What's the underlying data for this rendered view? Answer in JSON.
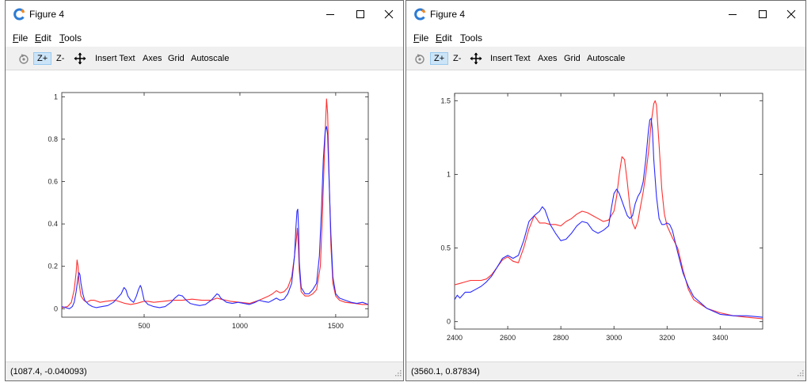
{
  "windows": [
    {
      "id": "left",
      "title": "Figure 4",
      "menu": [
        {
          "label": "File",
          "accel": "F",
          "rest": "ile"
        },
        {
          "label": "Edit",
          "accel": "E",
          "rest": "dit"
        },
        {
          "label": "Tools",
          "accel": "T",
          "rest": "ools"
        }
      ],
      "toolbar": {
        "zoom_in": "Z+",
        "zoom_out": "Z-",
        "insert_text": "Insert Text",
        "axes": "Axes",
        "grid": "Grid",
        "autoscale": "Autoscale"
      },
      "status": "(1087.4, -0.040093)"
    },
    {
      "id": "right",
      "title": "Figure 4",
      "menu": [
        {
          "label": "File",
          "accel": "F",
          "rest": "ile"
        },
        {
          "label": "Edit",
          "accel": "E",
          "rest": "dit"
        },
        {
          "label": "Tools",
          "accel": "T",
          "rest": "ools"
        }
      ],
      "toolbar": {
        "zoom_in": "Z+",
        "zoom_out": "Z-",
        "insert_text": "Insert Text",
        "axes": "Axes",
        "grid": "Grid",
        "autoscale": "Autoscale"
      },
      "status": "(3560.1, 0.87834)"
    }
  ],
  "icons": {
    "app": "octave-logo-icon",
    "minimize": "minimize-icon",
    "maximize": "maximize-icon",
    "close": "close-icon",
    "rotate": "rotate-icon",
    "pan": "pan-icon"
  },
  "colors": {
    "series_red": "#ff3030",
    "series_blue": "#2a2aff",
    "zoom_active_bg": "#cce4f7"
  },
  "chart_data": [
    {
      "type": "line",
      "xlim": [
        70,
        1670
      ],
      "ylim": [
        -0.04,
        1.02
      ],
      "xticks": [
        500,
        1000,
        1500
      ],
      "yticks": [
        0,
        0.2,
        0.4,
        0.6,
        0.8,
        1
      ],
      "ytick_labels": [
        "0",
        "0.2",
        "0.4",
        "0.6",
        "0.8",
        "1"
      ],
      "grid": false,
      "series": [
        {
          "color": "#ff3030",
          "x": [
            70,
            100,
            120,
            135,
            145,
            150,
            155,
            160,
            170,
            185,
            200,
            220,
            240,
            270,
            300,
            350,
            400,
            430,
            460,
            480,
            500,
            520,
            550,
            600,
            650,
            700,
            750,
            800,
            850,
            880,
            900,
            950,
            1000,
            1050,
            1100,
            1150,
            1170,
            1190,
            1210,
            1230,
            1250,
            1270,
            1285,
            1295,
            1300,
            1305,
            1310,
            1320,
            1340,
            1360,
            1380,
            1400,
            1420,
            1430,
            1440,
            1447,
            1452,
            1458,
            1465,
            1475,
            1485,
            1500,
            1520,
            1550,
            1600,
            1640,
            1670
          ],
          "y": [
            0.005,
            0.01,
            0.03,
            0.09,
            0.17,
            0.23,
            0.2,
            0.12,
            0.06,
            0.04,
            0.03,
            0.04,
            0.04,
            0.03,
            0.035,
            0.04,
            0.025,
            0.02,
            0.025,
            0.03,
            0.035,
            0.035,
            0.03,
            0.035,
            0.04,
            0.04,
            0.045,
            0.04,
            0.04,
            0.05,
            0.045,
            0.035,
            0.03,
            0.025,
            0.04,
            0.06,
            0.07,
            0.085,
            0.075,
            0.08,
            0.1,
            0.15,
            0.25,
            0.33,
            0.38,
            0.3,
            0.18,
            0.08,
            0.06,
            0.06,
            0.07,
            0.09,
            0.2,
            0.42,
            0.7,
            0.88,
            0.99,
            0.92,
            0.65,
            0.3,
            0.12,
            0.06,
            0.04,
            0.03,
            0.025,
            0.02,
            0.02
          ]
        },
        {
          "color": "#2a2aff",
          "x": [
            70,
            90,
            110,
            125,
            135,
            145,
            155,
            160,
            165,
            170,
            180,
            190,
            200,
            210,
            230,
            250,
            280,
            310,
            340,
            360,
            380,
            395,
            405,
            415,
            430,
            445,
            460,
            470,
            480,
            485,
            490,
            500,
            520,
            550,
            580,
            610,
            640,
            660,
            680,
            700,
            720,
            740,
            760,
            790,
            820,
            850,
            870,
            880,
            890,
            900,
            930,
            960,
            990,
            1020,
            1050,
            1080,
            1100,
            1120,
            1150,
            1170,
            1190,
            1210,
            1230,
            1250,
            1270,
            1285,
            1292,
            1298,
            1302,
            1306,
            1310,
            1320,
            1340,
            1360,
            1380,
            1400,
            1415,
            1425,
            1435,
            1445,
            1452,
            1458,
            1465,
            1475,
            1485,
            1500,
            1520,
            1550,
            1580,
            1610,
            1640,
            1670
          ],
          "y": [
            0.01,
            0.005,
            0,
            0.01,
            0.03,
            0.08,
            0.15,
            0.17,
            0.16,
            0.12,
            0.07,
            0.04,
            0.03,
            0.02,
            0.01,
            0.005,
            0.01,
            0.015,
            0.03,
            0.05,
            0.07,
            0.1,
            0.09,
            0.06,
            0.04,
            0.03,
            0.06,
            0.09,
            0.11,
            0.1,
            0.08,
            0.04,
            0.02,
            0.01,
            0.005,
            0.01,
            0.03,
            0.05,
            0.065,
            0.06,
            0.04,
            0.025,
            0.02,
            0.015,
            0.02,
            0.04,
            0.06,
            0.07,
            0.065,
            0.05,
            0.03,
            0.025,
            0.03,
            0.025,
            0.02,
            0.03,
            0.04,
            0.035,
            0.03,
            0.04,
            0.05,
            0.04,
            0.045,
            0.07,
            0.12,
            0.25,
            0.38,
            0.46,
            0.47,
            0.38,
            0.22,
            0.1,
            0.07,
            0.07,
            0.09,
            0.12,
            0.25,
            0.45,
            0.7,
            0.84,
            0.86,
            0.82,
            0.62,
            0.35,
            0.15,
            0.07,
            0.05,
            0.04,
            0.03,
            0.025,
            0.03,
            0.02
          ]
        }
      ]
    },
    {
      "type": "line",
      "xlim": [
        2400,
        3560
      ],
      "ylim": [
        -0.05,
        1.55
      ],
      "xticks": [
        2400,
        2600,
        2800,
        3000,
        3200,
        3400
      ],
      "yticks": [
        0,
        0.5,
        1,
        1.5
      ],
      "ytick_labels": [
        "0",
        "0.5",
        "1",
        "1.5"
      ],
      "grid": false,
      "series": [
        {
          "color": "#ff3030",
          "x": [
            2400,
            2420,
            2440,
            2460,
            2480,
            2500,
            2520,
            2540,
            2560,
            2580,
            2600,
            2620,
            2640,
            2660,
            2680,
            2700,
            2720,
            2740,
            2760,
            2780,
            2800,
            2820,
            2840,
            2860,
            2880,
            2900,
            2920,
            2940,
            2960,
            2980,
            3000,
            3010,
            3020,
            3030,
            3040,
            3050,
            3060,
            3070,
            3080,
            3090,
            3100,
            3110,
            3120,
            3130,
            3140,
            3150,
            3155,
            3160,
            3170,
            3180,
            3190,
            3200,
            3220,
            3240,
            3260,
            3280,
            3300,
            3350,
            3400,
            3450,
            3500,
            3560
          ],
          "y": [
            0.25,
            0.26,
            0.27,
            0.28,
            0.28,
            0.28,
            0.29,
            0.32,
            0.37,
            0.42,
            0.44,
            0.41,
            0.4,
            0.5,
            0.63,
            0.72,
            0.67,
            0.67,
            0.66,
            0.66,
            0.65,
            0.68,
            0.7,
            0.73,
            0.75,
            0.74,
            0.72,
            0.7,
            0.68,
            0.69,
            0.75,
            0.85,
            1.0,
            1.12,
            1.1,
            0.95,
            0.78,
            0.67,
            0.63,
            0.68,
            0.78,
            0.88,
            1.0,
            1.15,
            1.35,
            1.48,
            1.5,
            1.47,
            1.2,
            0.9,
            0.73,
            0.65,
            0.57,
            0.5,
            0.35,
            0.22,
            0.15,
            0.09,
            0.06,
            0.04,
            0.03,
            0.02
          ]
        },
        {
          "color": "#2a2aff",
          "x": [
            2400,
            2410,
            2420,
            2440,
            2460,
            2480,
            2500,
            2520,
            2540,
            2560,
            2580,
            2600,
            2620,
            2640,
            2660,
            2680,
            2700,
            2720,
            2730,
            2740,
            2760,
            2780,
            2800,
            2820,
            2840,
            2860,
            2880,
            2900,
            2920,
            2940,
            2960,
            2980,
            2990,
            3000,
            3010,
            3020,
            3030,
            3040,
            3050,
            3060,
            3070,
            3080,
            3090,
            3100,
            3110,
            3120,
            3130,
            3135,
            3140,
            3145,
            3150,
            3160,
            3170,
            3180,
            3190,
            3200,
            3210,
            3220,
            3240,
            3260,
            3280,
            3300,
            3350,
            3400,
            3450,
            3500,
            3560
          ],
          "y": [
            0.15,
            0.18,
            0.16,
            0.2,
            0.2,
            0.22,
            0.24,
            0.27,
            0.31,
            0.37,
            0.43,
            0.45,
            0.43,
            0.45,
            0.55,
            0.68,
            0.72,
            0.75,
            0.78,
            0.76,
            0.66,
            0.6,
            0.55,
            0.56,
            0.6,
            0.65,
            0.68,
            0.67,
            0.62,
            0.6,
            0.62,
            0.65,
            0.77,
            0.87,
            0.9,
            0.87,
            0.82,
            0.77,
            0.72,
            0.7,
            0.72,
            0.8,
            0.85,
            0.88,
            0.95,
            1.1,
            1.3,
            1.37,
            1.38,
            1.3,
            1.1,
            0.85,
            0.7,
            0.66,
            0.66,
            0.67,
            0.66,
            0.62,
            0.47,
            0.33,
            0.24,
            0.17,
            0.09,
            0.05,
            0.04,
            0.04,
            0.03
          ]
        }
      ]
    }
  ]
}
